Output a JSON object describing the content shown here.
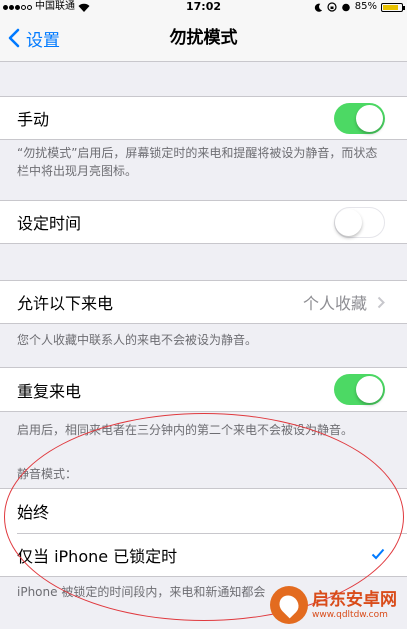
{
  "status_bar": {
    "carrier": "中国联通",
    "time": "17:02",
    "battery": "85%",
    "battery_level": 0.85
  },
  "nav": {
    "back_label": "设置",
    "title": "勿扰模式"
  },
  "manual": {
    "label": "手动",
    "toggle_on": true,
    "note": "“勿扰模式”启用后，屏幕锁定时的来电和提醒将被设为静音，而状态栏中将出现月亮图标。"
  },
  "scheduled": {
    "label": "设定时间",
    "toggle_on": false
  },
  "allow_calls": {
    "label": "允许以下来电",
    "value": "个人收藏",
    "note": "您个人收藏中联系人的来电不会被设为静音。"
  },
  "repeated_calls": {
    "label": "重复来电",
    "toggle_on": true,
    "note": "启用后，相同来电者在三分钟内的第二个来电不会被设为静音。"
  },
  "silence": {
    "header": "静音模式：",
    "options": [
      {
        "label": "始终",
        "selected": false
      },
      {
        "label": "仅当 iPhone 已锁定时",
        "selected": true
      }
    ],
    "note": "iPhone 被锁定的时间段内，来电和新通知都会"
  },
  "watermark": {
    "title": "启东安卓网",
    "url": "www.qdltdw.com"
  },
  "colors": {
    "accent": "#007aff",
    "toggle_on": "#4cd964",
    "annotation": "#e0393e",
    "watermark": "#d94c1a"
  }
}
